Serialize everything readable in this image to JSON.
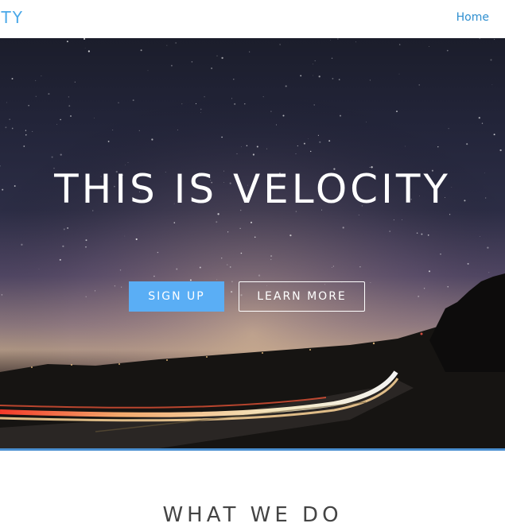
{
  "navbar": {
    "brand": "VELOCITY",
    "home_label": "Home"
  },
  "hero": {
    "title": "THIS IS VELOCITY",
    "signup_label": "SIGN UP",
    "learn_more_label": "LEARN MORE"
  },
  "section": {
    "title": "WHAT WE DO"
  },
  "colors": {
    "accent": "#5aaef5",
    "brand": "#4aa8e8",
    "link": "#2f8fd0"
  }
}
